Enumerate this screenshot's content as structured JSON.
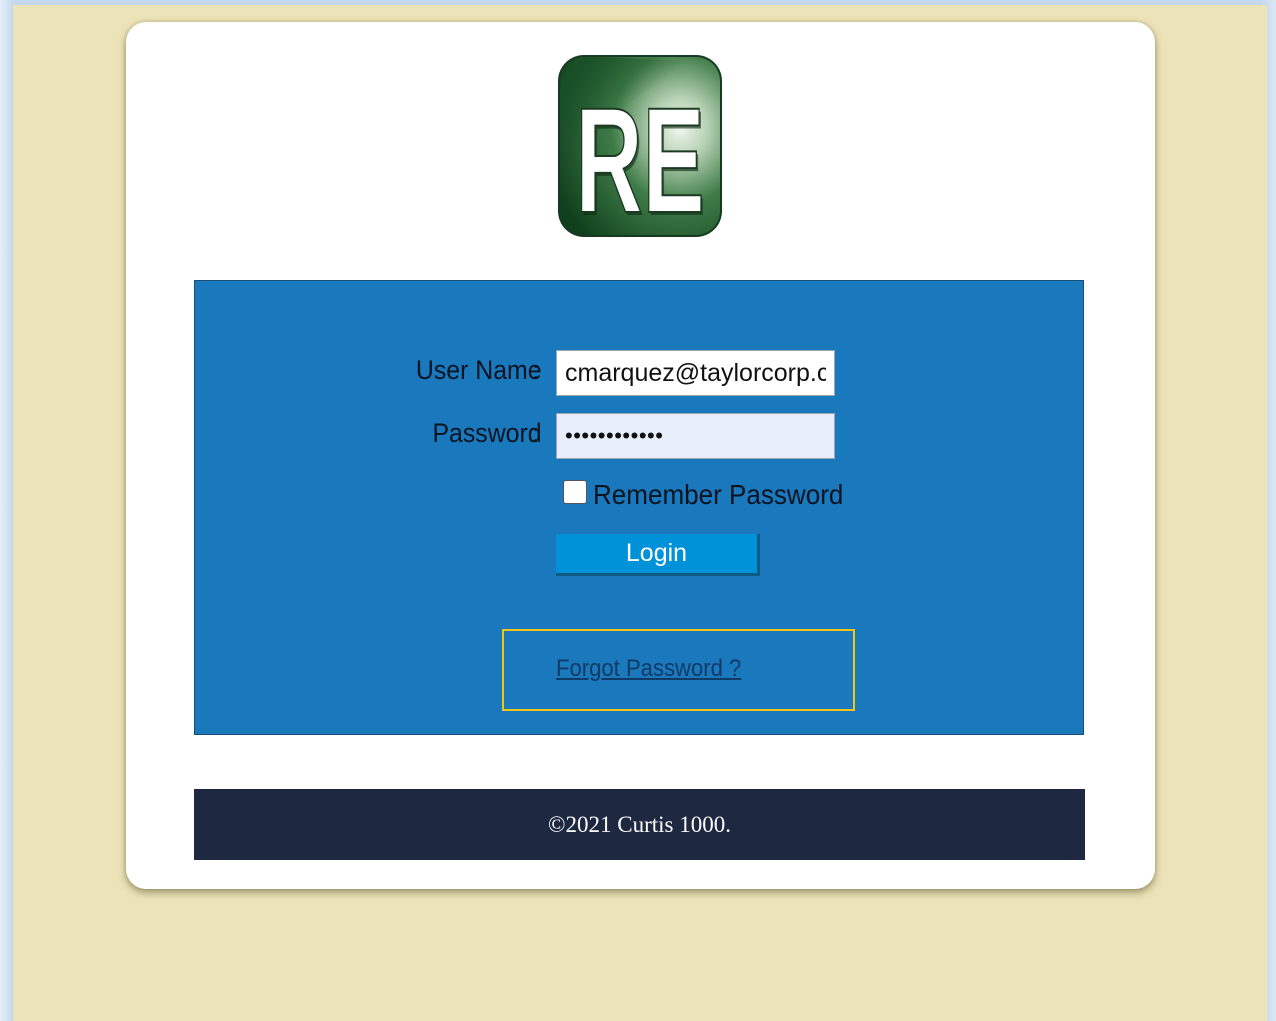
{
  "login": {
    "username_label": "User Name",
    "password_label": "Password",
    "separator": ":",
    "username_value": "cmarquez@taylorcorp.c",
    "password_value": "••••••••••••",
    "remember_label": "Remember Password",
    "remember_checked": false,
    "login_button": "Login",
    "forgot_link": "Forgot Password ?"
  },
  "footer": {
    "copyright": "©2021 Curtis 1000."
  },
  "logo": {
    "text": "RE",
    "icon": "re-logo"
  },
  "colors": {
    "page_background": "#ede3b9",
    "panel_blue": "#1a78bd",
    "button_blue": "#0092d8",
    "footer_navy": "#1e2840",
    "highlight_yellow": "#f0c419",
    "logo_green": "#2e6b3a"
  }
}
